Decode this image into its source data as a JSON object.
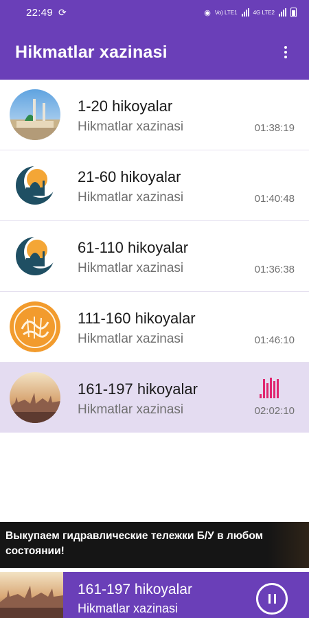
{
  "status_bar": {
    "time": "22:49",
    "sync_icon": "sync-icon",
    "network_label": "Vo) LTE1",
    "lte_label": "4G LTE2"
  },
  "app_bar": {
    "title": "Hikmatlar xazinasi",
    "menu_icon": "more-vert-icon"
  },
  "list": {
    "items": [
      {
        "title": "1-20 hikoyalar",
        "subtitle": "Hikmatlar xazinasi",
        "duration": "01:38:19",
        "thumb": "mosque-photo"
      },
      {
        "title": "21-60 hikoyalar",
        "subtitle": "Hikmatlar xazinasi",
        "duration": "01:40:48",
        "thumb": "mosque-crescent-icon"
      },
      {
        "title": "61-110 hikoyalar",
        "subtitle": "Hikmatlar xazinasi",
        "duration": "01:36:38",
        "thumb": "mosque-crescent-icon"
      },
      {
        "title": "111-160 hikoyalar",
        "subtitle": "Hikmatlar xazinasi",
        "duration": "01:46:10",
        "thumb": "calligraphy-seal"
      },
      {
        "title": "161-197 hikoyalar",
        "subtitle": "Hikmatlar xazinasi",
        "duration": "02:02:10",
        "thumb": "sunset-city-photo",
        "playing": true
      }
    ]
  },
  "ad": {
    "text": "Выкупаем гидравлические тележки Б/У в любом состоянии!"
  },
  "player": {
    "title": "161-197 hikoyalar",
    "subtitle": "Hikmatlar xazinasi",
    "button_icon": "pause-icon"
  },
  "colors": {
    "primary": "#6a3fb8",
    "active_row": "#e4dcf1",
    "equalizer": "#e0266f"
  }
}
